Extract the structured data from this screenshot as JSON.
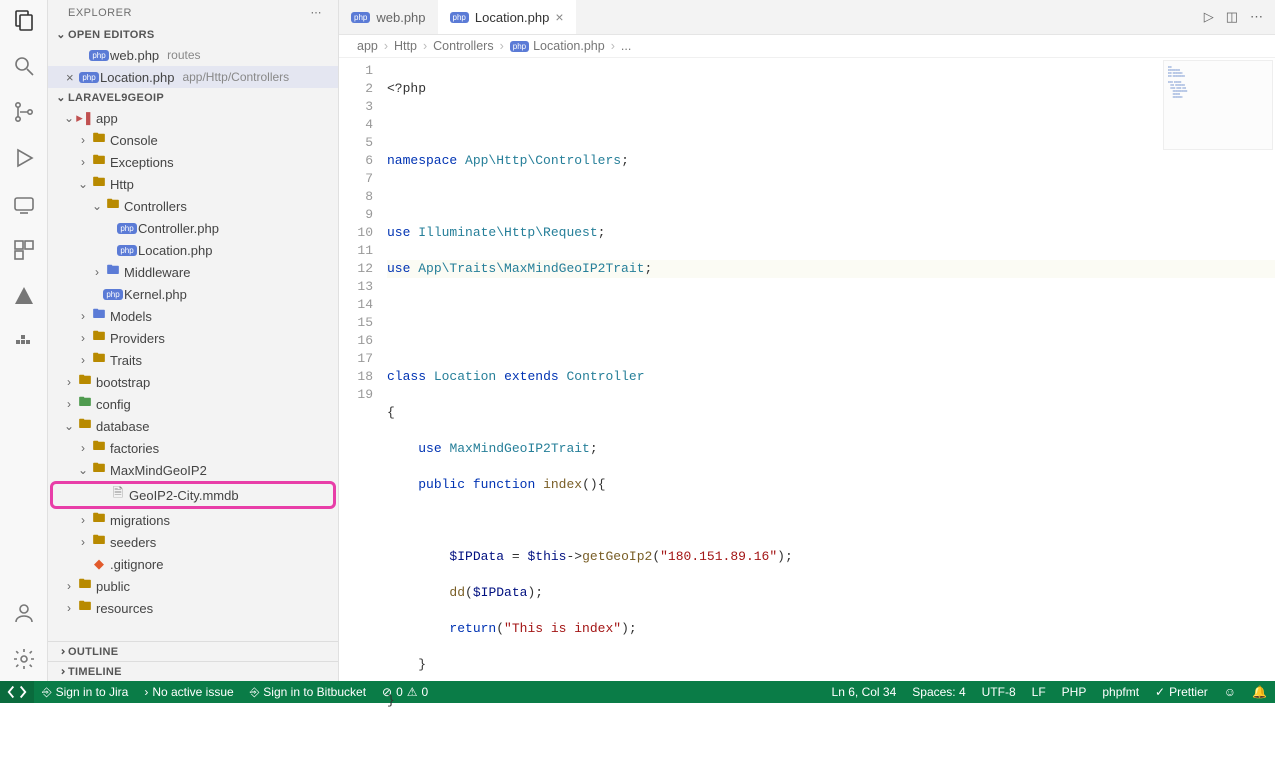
{
  "sidebar": {
    "title": "EXPLORER",
    "openEditors": "OPEN EDITORS",
    "project": "LARAVEL9GEOIP",
    "outline": "OUTLINE",
    "timeline": "TIMELINE",
    "openFiles": [
      {
        "name": "web.php",
        "meta": "routes"
      },
      {
        "name": "Location.php",
        "meta": "app/Http/Controllers"
      }
    ],
    "tree": {
      "app": "app",
      "console": "Console",
      "exceptions": "Exceptions",
      "http": "Http",
      "controllers": "Controllers",
      "controllerphp": "Controller.php",
      "locationphp": "Location.php",
      "middleware": "Middleware",
      "kernelphp": "Kernel.php",
      "models": "Models",
      "providers": "Providers",
      "traits": "Traits",
      "bootstrap": "bootstrap",
      "config": "config",
      "database": "database",
      "factories": "factories",
      "maxmind": "MaxMindGeoIP2",
      "geoipfile": "GeoIP2-City.mmdb",
      "migrations": "migrations",
      "seeders": "seeders",
      "gitignore": ".gitignore",
      "public": "public",
      "resources": "resources"
    }
  },
  "tabs": [
    {
      "name": "web.php"
    },
    {
      "name": "Location.php"
    }
  ],
  "breadcrumb": {
    "p0": "app",
    "p1": "Http",
    "p2": "Controllers",
    "p3": "Location.php",
    "p4": "..."
  },
  "code": {
    "l1": "<?php",
    "l3a": "namespace",
    "l3b": "App\\Http\\Controllers",
    "l5a": "use",
    "l5b": "Illuminate\\Http\\Request",
    "l6a": "use",
    "l6b": "App\\Traits\\MaxMindGeoIP2Trait",
    "l9a": "class",
    "l9b": "Location",
    "l9c": "extends",
    "l9d": "Controller",
    "l11a": "use",
    "l11b": "MaxMindGeoIP2Trait",
    "l12a": "public",
    "l12b": "function",
    "l12c": "index",
    "l14a": "$IPData",
    "l14b": "$this",
    "l14c": "getGeoIp2",
    "l14d": "\"180.151.89.16\"",
    "l15a": "dd",
    "l15b": "$IPData",
    "l16a": "return",
    "l16b": "\"This is index\""
  },
  "status": {
    "jira": "Sign in to Jira",
    "issue": "No active issue",
    "bitbucket": "Sign in to Bitbucket",
    "errors": "0",
    "warnings": "0",
    "lncol": "Ln 6, Col 34",
    "spaces": "Spaces: 4",
    "encoding": "UTF-8",
    "eol": "LF",
    "lang": "PHP",
    "fmt": "phpfmt",
    "prettier": "Prettier"
  }
}
